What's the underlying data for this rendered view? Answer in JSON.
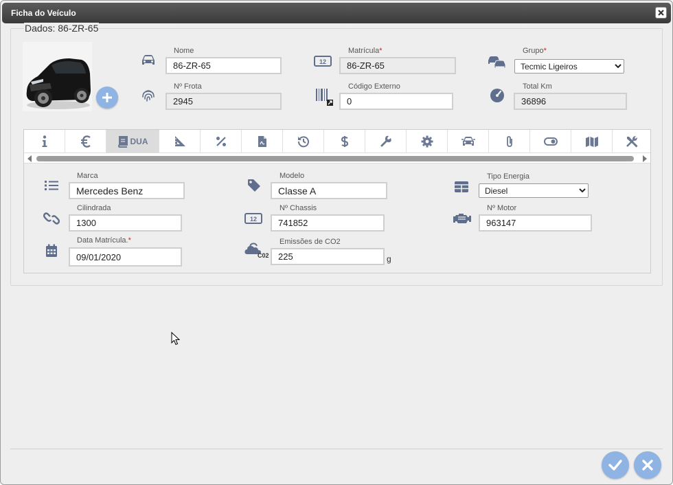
{
  "window": {
    "title": "Ficha do Veículo"
  },
  "fieldset": {
    "legend": "Dados: 86-ZR-65"
  },
  "header_fields": {
    "nome": {
      "label": "Nome",
      "value": "86-ZR-65"
    },
    "matricula": {
      "label": "Matrícula",
      "required": "*",
      "value": "86-ZR-65"
    },
    "grupo": {
      "label": "Grupo",
      "required": "*",
      "value": "Tecmic Ligeiros"
    },
    "frota": {
      "label": "Nº Frota",
      "value": "2945"
    },
    "codigo_externo": {
      "label": "Código Externo",
      "value": "0"
    },
    "total_km": {
      "label": "Total Km",
      "value": "36896"
    }
  },
  "tabs": [
    {
      "icon": "info-icon"
    },
    {
      "icon": "euro-icon"
    },
    {
      "icon": "book-icon",
      "label": "DUA",
      "active": true
    },
    {
      "icon": "set-square-icon"
    },
    {
      "icon": "percent-icon"
    },
    {
      "icon": "pdf-file-icon"
    },
    {
      "icon": "history-icon"
    },
    {
      "icon": "dollar-icon"
    },
    {
      "icon": "wrench-icon"
    },
    {
      "icon": "gear-icon"
    },
    {
      "icon": "car-front-icon"
    },
    {
      "icon": "paperclip-icon"
    },
    {
      "icon": "toggle-icon"
    },
    {
      "icon": "map-icon"
    },
    {
      "icon": "tools-icon"
    }
  ],
  "dua": {
    "marca": {
      "label": "Marca",
      "value": "Mercedes Benz"
    },
    "modelo": {
      "label": "Modelo",
      "value": "Classe A"
    },
    "tipo_energia": {
      "label": "Tipo Energia",
      "value": "Diesel"
    },
    "cilindrada": {
      "label": "Cilindrada",
      "value": "1300"
    },
    "chassis": {
      "label": "Nº Chassis",
      "value": "741852"
    },
    "motor": {
      "label": "Nº Motor",
      "value": "963147"
    },
    "data_matricula": {
      "label": "Data Matrícula.",
      "required": "*",
      "value": "09/01/2020"
    },
    "emissoes": {
      "label": "Emissões de CO2",
      "value": "225",
      "unit": "g",
      "icon_text": "C02"
    }
  },
  "colors": {
    "accent": "#8fb3e3",
    "icon": "#5f6e8c",
    "title_bar": "#4a4a4a",
    "required": "#cc2222"
  }
}
